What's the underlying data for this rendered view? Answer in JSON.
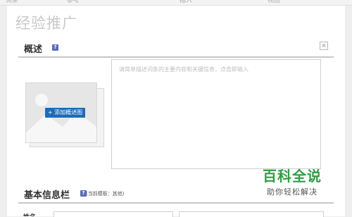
{
  "topbar": {
    "tabs": [
      "词条",
      "参考",
      "插入",
      "视图"
    ]
  },
  "page": {
    "title": "经验推广"
  },
  "overview": {
    "title": "概述",
    "help_icon": "question-icon",
    "close_glyph": "×",
    "add_image_label": "+ 添加概述图",
    "description_placeholder": "请简单描述词条的主要内容和关键信息，点击即输入"
  },
  "infobox": {
    "title": "基本信息栏",
    "help_icon": "question-icon",
    "template_note": "(当前模板：其他)",
    "first_field_label": "姓名"
  },
  "watermark": {
    "main": "百科全说",
    "sub": "助你轻松解决"
  },
  "colors": {
    "add_button": "#1e6bb8",
    "help_icon": "#5c6bb8",
    "watermark": "#2f9e44"
  }
}
